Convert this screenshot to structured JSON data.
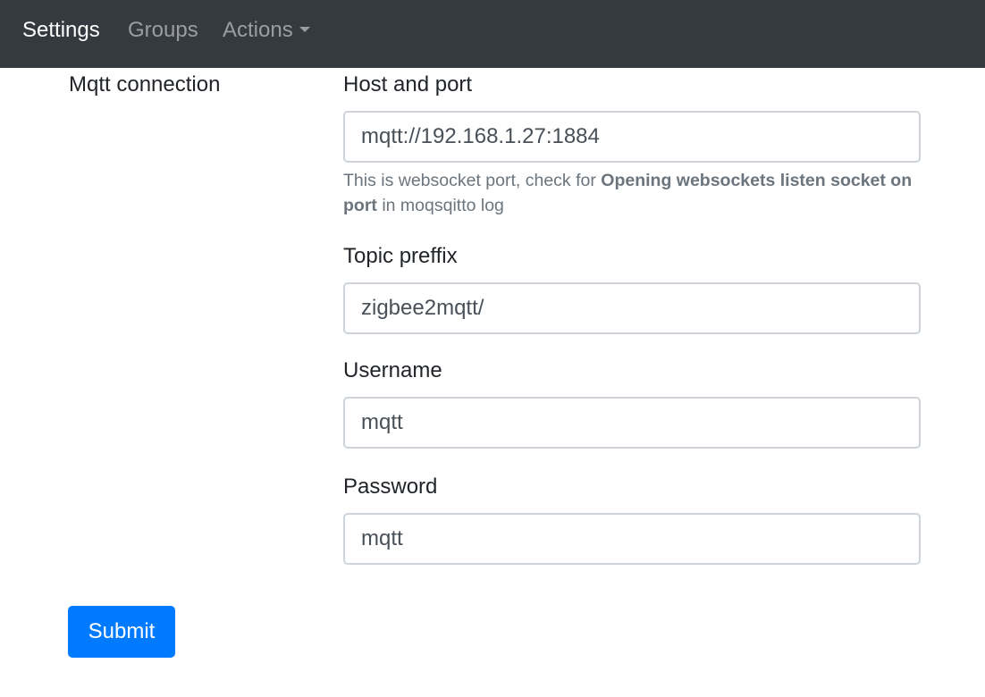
{
  "navbar": {
    "items": [
      {
        "label": "Settings",
        "active": true
      },
      {
        "label": "Groups",
        "active": false
      },
      {
        "label": "Actions",
        "active": false,
        "dropdown": true
      }
    ]
  },
  "form": {
    "section_label": "Mqtt connection",
    "host": {
      "label": "Host and port",
      "value": "mqtt://192.168.1.27:1884",
      "help_prefix": "This is websocket port, check for ",
      "help_bold": "Opening websockets listen socket on port",
      "help_suffix": " in moqsqitto log"
    },
    "topic": {
      "label": "Topic preffix",
      "value": "zigbee2mqtt/"
    },
    "username": {
      "label": "Username",
      "value": "mqtt"
    },
    "password": {
      "label": "Password",
      "value": "mqtt"
    },
    "submit_label": "Submit"
  },
  "colors": {
    "navbar_bg": "#343a40",
    "primary": "#007bff",
    "muted_text": "#6c757d",
    "input_border": "#ced4da"
  }
}
